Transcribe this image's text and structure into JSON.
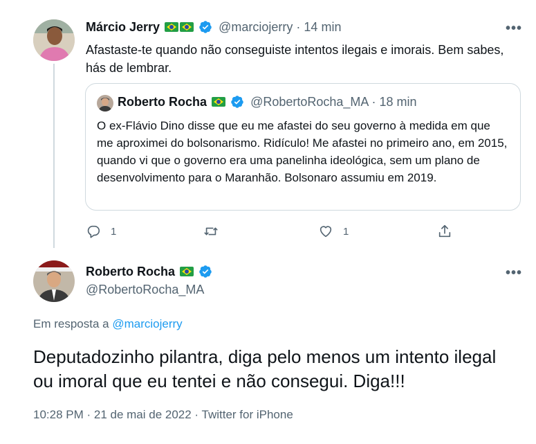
{
  "reply_tweet": {
    "display_name": "Márcio Jerry",
    "handle": "@marciojerry",
    "separator": "·",
    "time": "14 min",
    "text": "Afastaste-te quando não conseguiste intentos ilegais e imorais. Bem sabes, hás de lembrar.",
    "more_label": "•••",
    "quoted": {
      "display_name": "Roberto Rocha",
      "handle": "@RobertoRocha_MA",
      "separator": "·",
      "time": "18 min",
      "text": "O ex-Flávio Dino disse que eu me afastei do seu governo à medida em que me aproximei do bolsonarismo. Ridículo! Me afastei no primeiro ano, em 2015, quando vi que o governo era uma panelinha ideológica, sem um plano de desenvolvimento para o Maranhão. Bolsonaro assumiu em 2019."
    },
    "actions": {
      "reply_count": "1",
      "retweet_count": "",
      "like_count": "1"
    }
  },
  "main_tweet": {
    "display_name": "Roberto Rocha",
    "handle": "@RobertoRocha_MA",
    "more_label": "•••",
    "reply_prefix": "Em resposta a ",
    "reply_to": "@marciojerry",
    "text": "Deputadozinho pilantra, diga pelo menos um intento ilegal ou imoral que eu tentei e não consegui. Diga!!!",
    "meta": "10:28 PM · 21 de mai de 2022 · Twitter for iPhone"
  },
  "colors": {
    "accent": "#1d9bf0",
    "muted": "#536471",
    "border": "#cfd9de"
  }
}
